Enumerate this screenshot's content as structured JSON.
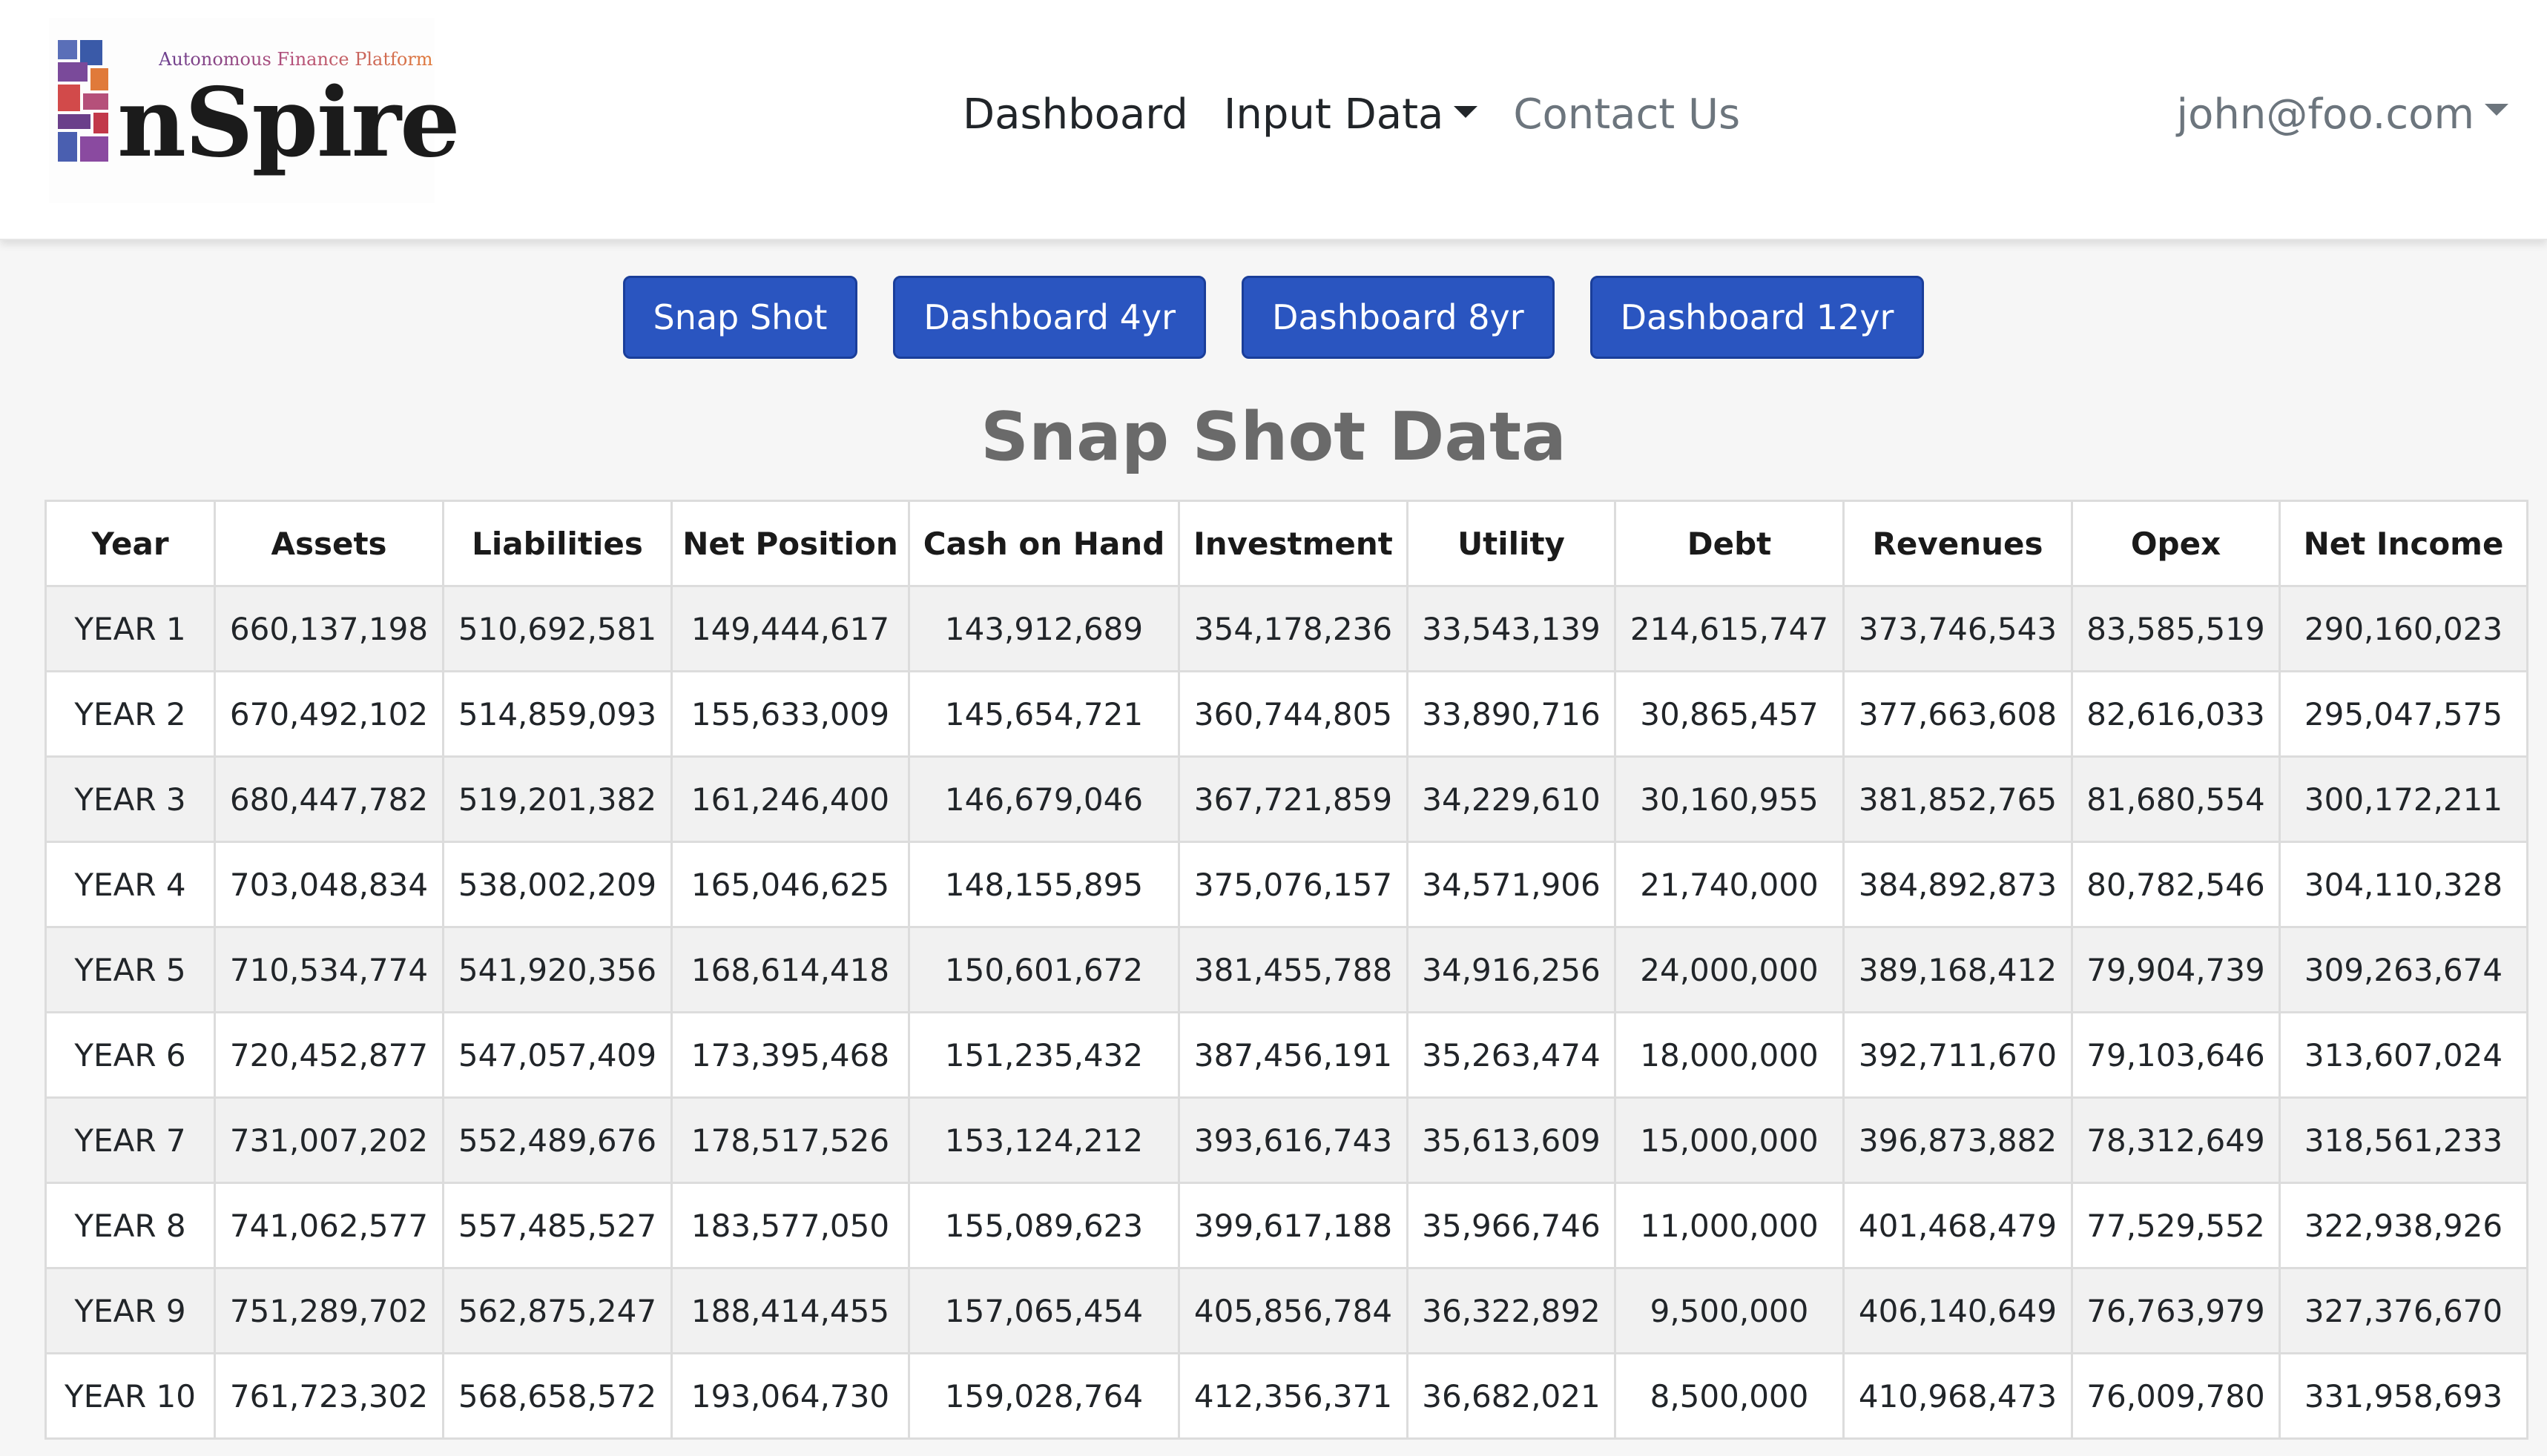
{
  "brand": {
    "tagline": "Autonomous Finance Platform",
    "name": "nSpire",
    "colors": [
      "#5a6fb8",
      "#7a4a9a",
      "#d24a4a",
      "#e07a3a",
      "#2f4e9a"
    ]
  },
  "nav": {
    "dashboard": "Dashboard",
    "input_data": "Input Data",
    "contact_us": "Contact Us",
    "user_email": "john@foo.com"
  },
  "buttons": {
    "snap_shot": "Snap Shot",
    "dashboard_4yr": "Dashboard 4yr",
    "dashboard_8yr": "Dashboard 8yr",
    "dashboard_12yr": "Dashboard 12yr"
  },
  "page_title": "Snap Shot Data",
  "table": {
    "headers": [
      "Year",
      "Assets",
      "Liabilities",
      "Net Position",
      "Cash on Hand",
      "Investment",
      "Utility",
      "Debt",
      "Revenues",
      "Opex",
      "Net Income"
    ],
    "rows": [
      [
        "YEAR 1",
        "660,137,198",
        "510,692,581",
        "149,444,617",
        "143,912,689",
        "354,178,236",
        "33,543,139",
        "214,615,747",
        "373,746,543",
        "83,585,519",
        "290,160,023"
      ],
      [
        "YEAR 2",
        "670,492,102",
        "514,859,093",
        "155,633,009",
        "145,654,721",
        "360,744,805",
        "33,890,716",
        "30,865,457",
        "377,663,608",
        "82,616,033",
        "295,047,575"
      ],
      [
        "YEAR 3",
        "680,447,782",
        "519,201,382",
        "161,246,400",
        "146,679,046",
        "367,721,859",
        "34,229,610",
        "30,160,955",
        "381,852,765",
        "81,680,554",
        "300,172,211"
      ],
      [
        "YEAR 4",
        "703,048,834",
        "538,002,209",
        "165,046,625",
        "148,155,895",
        "375,076,157",
        "34,571,906",
        "21,740,000",
        "384,892,873",
        "80,782,546",
        "304,110,328"
      ],
      [
        "YEAR 5",
        "710,534,774",
        "541,920,356",
        "168,614,418",
        "150,601,672",
        "381,455,788",
        "34,916,256",
        "24,000,000",
        "389,168,412",
        "79,904,739",
        "309,263,674"
      ],
      [
        "YEAR 6",
        "720,452,877",
        "547,057,409",
        "173,395,468",
        "151,235,432",
        "387,456,191",
        "35,263,474",
        "18,000,000",
        "392,711,670",
        "79,103,646",
        "313,607,024"
      ],
      [
        "YEAR 7",
        "731,007,202",
        "552,489,676",
        "178,517,526",
        "153,124,212",
        "393,616,743",
        "35,613,609",
        "15,000,000",
        "396,873,882",
        "78,312,649",
        "318,561,233"
      ],
      [
        "YEAR 8",
        "741,062,577",
        "557,485,527",
        "183,577,050",
        "155,089,623",
        "399,617,188",
        "35,966,746",
        "11,000,000",
        "401,468,479",
        "77,529,552",
        "322,938,926"
      ],
      [
        "YEAR 9",
        "751,289,702",
        "562,875,247",
        "188,414,455",
        "157,065,454",
        "405,856,784",
        "36,322,892",
        "9,500,000",
        "406,140,649",
        "76,763,979",
        "327,376,670"
      ],
      [
        "YEAR 10",
        "761,723,302",
        "568,658,572",
        "193,064,730",
        "159,028,764",
        "412,356,371",
        "36,682,021",
        "8,500,000",
        "410,968,473",
        "76,009,780",
        "331,958,693"
      ]
    ]
  }
}
